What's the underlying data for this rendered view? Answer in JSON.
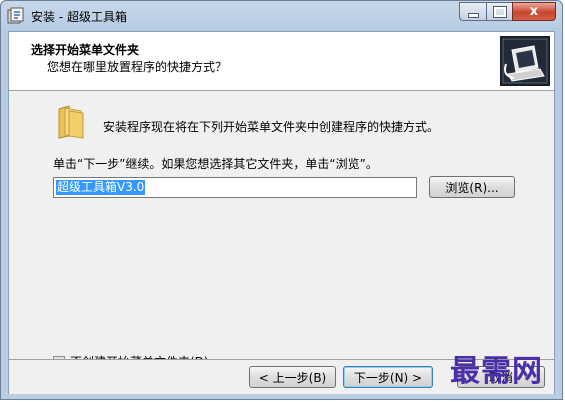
{
  "window": {
    "title": "安装 - 超级工具箱",
    "close_glyph": "x"
  },
  "header": {
    "title": "选择开始菜单文件夹",
    "subtitle": "您想在哪里放置程序的快捷方式？"
  },
  "body": {
    "info_text": "安装程序现在将在下列开始菜单文件夹中创建程序的快捷方式。",
    "click_text": "单击“下一步”继续。如果您想选择其它文件夹，单击“浏览”。",
    "folder_value": "超级工具箱V3.0",
    "browse_label": "浏览(R)...",
    "no_folder_label": "不创建开始菜单文件夹(D)",
    "no_folder_checked": false
  },
  "footer": {
    "back_label": "< 上一步(B)",
    "next_label": "下一步(N) >",
    "cancel_label": "取消"
  },
  "watermark": "最需网",
  "colors": {
    "selection": "#3399ff",
    "close_button": "#c8462f",
    "watermark": "#4a2fa8"
  }
}
